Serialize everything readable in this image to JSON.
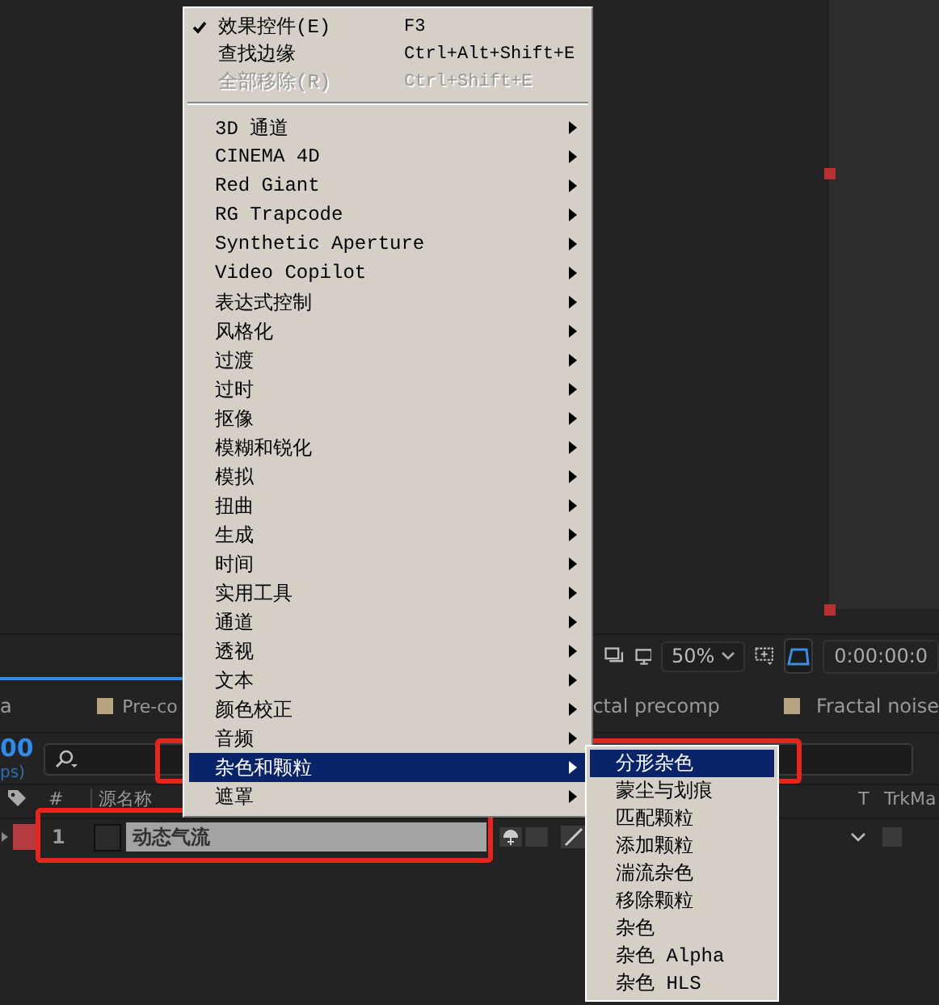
{
  "viewer": {
    "zoom": "50%",
    "timecode": "0:00:00:0"
  },
  "tabs": [
    {
      "label": "a",
      "kind": "plain"
    },
    {
      "label": "Pre-co",
      "kind": "swatch"
    },
    {
      "label": "ctal precomp",
      "kind": "plain"
    },
    {
      "label": "Fractal noise",
      "kind": "swatch"
    }
  ],
  "timeline": {
    "time": "00",
    "fps": "ps)",
    "columns": [
      "#",
      "源名称",
      "T",
      "TrkMa"
    ],
    "layers": [
      {
        "index": "1",
        "name": "动态气流",
        "selected": true
      }
    ]
  },
  "context_menu": {
    "items": [
      {
        "kind": "command",
        "label": "效果控件(E)",
        "shortcut": "F3",
        "checked": true,
        "disabled": false
      },
      {
        "kind": "command",
        "label": "查找边缘",
        "shortcut": "Ctrl+Alt+Shift+E",
        "checked": false,
        "disabled": false
      },
      {
        "kind": "command",
        "label": "全部移除(R)",
        "shortcut": "Ctrl+Shift+E",
        "checked": false,
        "disabled": true
      },
      {
        "kind": "separator"
      },
      {
        "kind": "submenu",
        "label": "3D 通道",
        "selected": false
      },
      {
        "kind": "submenu",
        "label": "CINEMA 4D",
        "selected": false
      },
      {
        "kind": "submenu",
        "label": "Red Giant",
        "selected": false
      },
      {
        "kind": "submenu",
        "label": "RG Trapcode",
        "selected": false
      },
      {
        "kind": "submenu",
        "label": "Synthetic Aperture",
        "selected": false
      },
      {
        "kind": "submenu",
        "label": "Video Copilot",
        "selected": false
      },
      {
        "kind": "submenu",
        "label": "表达式控制",
        "selected": false
      },
      {
        "kind": "submenu",
        "label": "风格化",
        "selected": false
      },
      {
        "kind": "submenu",
        "label": "过渡",
        "selected": false
      },
      {
        "kind": "submenu",
        "label": "过时",
        "selected": false
      },
      {
        "kind": "submenu",
        "label": "抠像",
        "selected": false
      },
      {
        "kind": "submenu",
        "label": "模糊和锐化",
        "selected": false
      },
      {
        "kind": "submenu",
        "label": "模拟",
        "selected": false
      },
      {
        "kind": "submenu",
        "label": "扭曲",
        "selected": false
      },
      {
        "kind": "submenu",
        "label": "生成",
        "selected": false
      },
      {
        "kind": "submenu",
        "label": "时间",
        "selected": false
      },
      {
        "kind": "submenu",
        "label": "实用工具",
        "selected": false
      },
      {
        "kind": "submenu",
        "label": "通道",
        "selected": false
      },
      {
        "kind": "submenu",
        "label": "透视",
        "selected": false
      },
      {
        "kind": "submenu",
        "label": "文本",
        "selected": false
      },
      {
        "kind": "submenu",
        "label": "颜色校正",
        "selected": false
      },
      {
        "kind": "submenu",
        "label": "音频",
        "selected": false
      },
      {
        "kind": "submenu",
        "label": "杂色和颗粒",
        "selected": true
      },
      {
        "kind": "submenu",
        "label": "遮罩",
        "selected": false
      }
    ]
  },
  "submenu": {
    "items": [
      {
        "label": "分形杂色",
        "selected": true
      },
      {
        "label": "蒙尘与划痕",
        "selected": false
      },
      {
        "label": "匹配颗粒",
        "selected": false
      },
      {
        "label": "添加颗粒",
        "selected": false
      },
      {
        "label": "湍流杂色",
        "selected": false
      },
      {
        "label": "移除颗粒",
        "selected": false
      },
      {
        "label": "杂色",
        "selected": false
      },
      {
        "label": "杂色 Alpha",
        "selected": false
      },
      {
        "label": "杂色 HLS",
        "selected": false
      }
    ]
  }
}
